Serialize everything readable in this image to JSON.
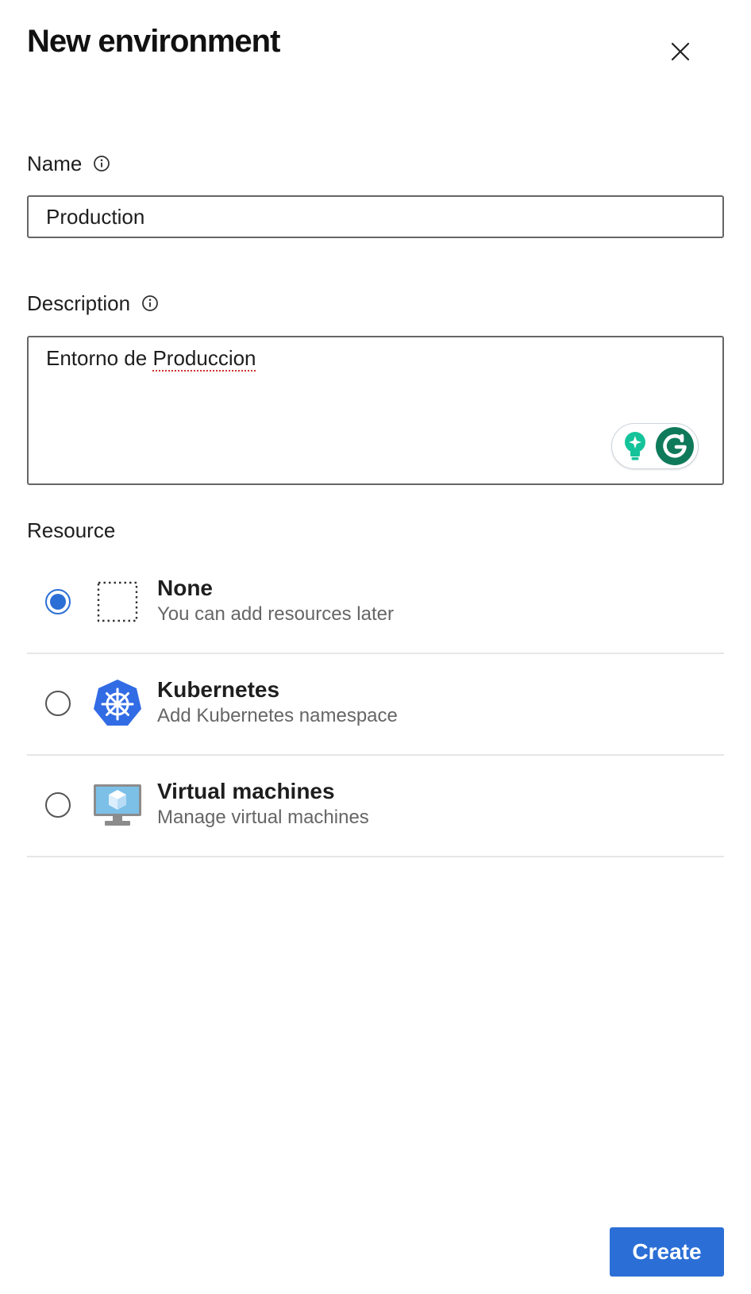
{
  "dialog": {
    "title": "New environment",
    "close_icon": "close-icon"
  },
  "name_field": {
    "label": "Name",
    "info_icon": "info-icon",
    "value": "Production"
  },
  "description_field": {
    "label": "Description",
    "info_icon": "info-icon",
    "value_prefix": "Entorno de ",
    "value_misspelled": "Produccion",
    "grammarly_icons": [
      "lightbulb-icon",
      "grammarly-g-icon"
    ]
  },
  "resource": {
    "label": "Resource",
    "options": [
      {
        "title": "None",
        "subtitle": "You can add resources later",
        "icon": "dashed-box-icon",
        "selected": true
      },
      {
        "title": "Kubernetes",
        "subtitle": "Add Kubernetes namespace",
        "icon": "kubernetes-icon",
        "selected": false
      },
      {
        "title": "Virtual machines",
        "subtitle": "Manage virtual machines",
        "icon": "virtual-machine-icon",
        "selected": false
      }
    ]
  },
  "footer": {
    "create_label": "Create"
  },
  "colors": {
    "accent": "#2b6fd6",
    "kubernetes_blue": "#326ce5",
    "grammarly_green": "#15c39a"
  }
}
